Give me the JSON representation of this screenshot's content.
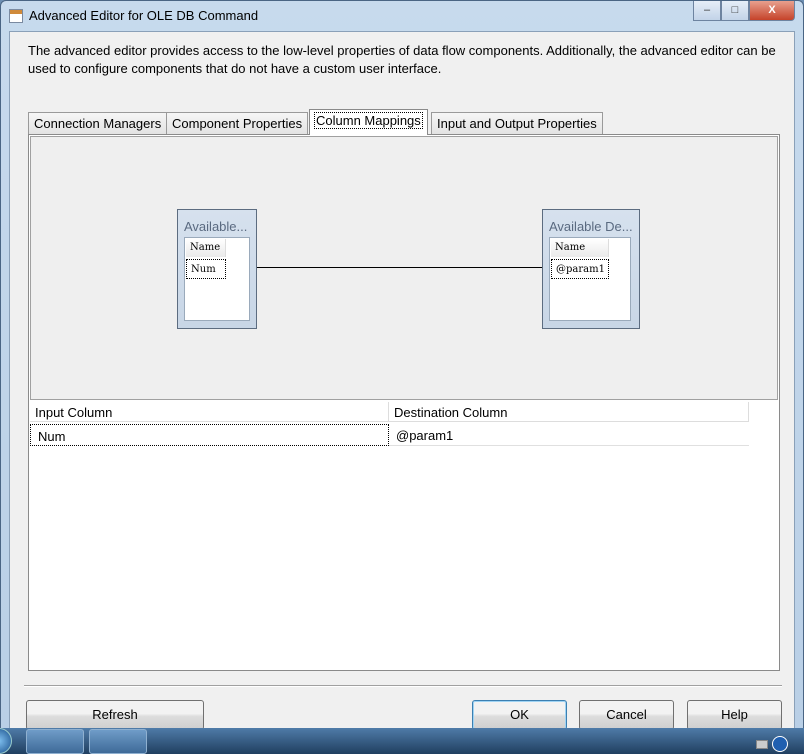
{
  "window": {
    "title": "Advanced Editor for OLE DB Command",
    "minimize": "–",
    "maximize": "□",
    "close": "X"
  },
  "description": "The advanced editor provides access to the low-level properties of data flow components. Additionally, the advanced editor can be used to configure components that do not have a custom user interface.",
  "tabs": [
    {
      "label": "Connection Managers"
    },
    {
      "label": "Component Properties"
    },
    {
      "label": "Column Mappings",
      "active": true
    },
    {
      "label": "Input and Output Properties"
    }
  ],
  "diagram": {
    "source": {
      "title": "Available...",
      "header": "Name",
      "columns": [
        "Num"
      ]
    },
    "destination": {
      "title": "Available De...",
      "header": "Name",
      "columns": [
        "@param1"
      ]
    }
  },
  "mapping_grid": {
    "headers": [
      "Input Column",
      "Destination Column"
    ],
    "rows": [
      [
        "Num",
        "@param1"
      ]
    ]
  },
  "buttons": {
    "refresh": "Refresh",
    "ok": "OK",
    "cancel": "Cancel",
    "help": "Help"
  }
}
